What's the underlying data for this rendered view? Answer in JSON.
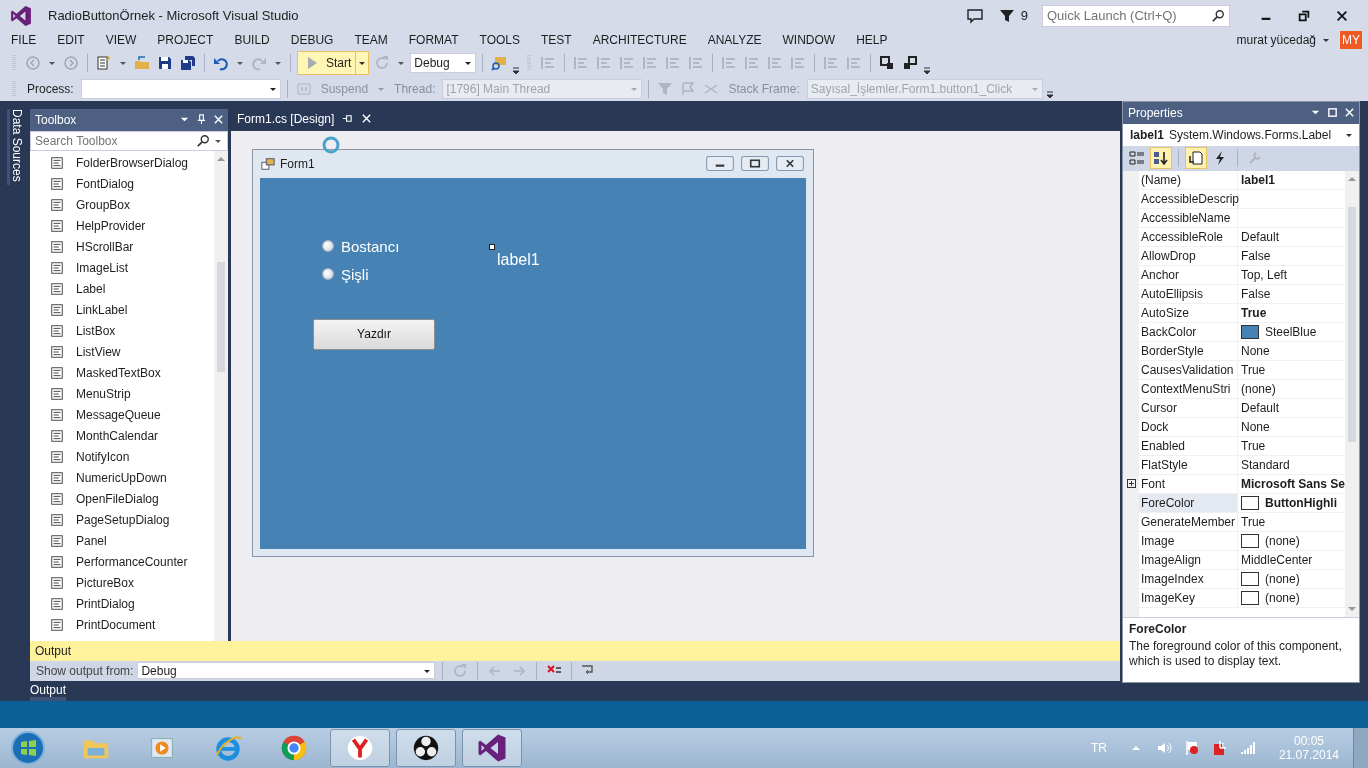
{
  "window": {
    "title": "RadioButtonÖrnek - Microsoft Visual Studio"
  },
  "title_bar": {
    "notification_count": "9",
    "quick_launch": {
      "placeholder": "Quick Launch (Ctrl+Q)"
    }
  },
  "menu": [
    "FILE",
    "EDIT",
    "VIEW",
    "PROJECT",
    "BUILD",
    "DEBUG",
    "TEAM",
    "FORMAT",
    "TOOLS",
    "TEST",
    "ARCHITECTURE",
    "ANALYZE",
    "WINDOW",
    "HELP"
  ],
  "user": {
    "name": "murat yücedağ",
    "initials": "MY"
  },
  "toolbar": {
    "start_label": "Start",
    "configuration": "Debug"
  },
  "debug_toolbar": {
    "process_label": "Process:",
    "suspend_label": "Suspend",
    "thread_label": "Thread:",
    "thread_value": "[1796] Main Thread",
    "stack_frame_label": "Stack Frame:",
    "stack_frame_value": "Sayısal_İşlemler.Form1.button1_Click"
  },
  "side_tab": "Data Sources",
  "toolbox": {
    "title": "Toolbox",
    "search": {
      "placeholder": "Search Toolbox"
    },
    "items": [
      "FolderBrowserDialog",
      "FontDialog",
      "GroupBox",
      "HelpProvider",
      "HScrollBar",
      "ImageList",
      "Label",
      "LinkLabel",
      "ListBox",
      "ListView",
      "MaskedTextBox",
      "MenuStrip",
      "MessageQueue",
      "MonthCalendar",
      "NotifyIcon",
      "NumericUpDown",
      "OpenFileDialog",
      "PageSetupDialog",
      "Panel",
      "PerformanceCounter",
      "PictureBox",
      "PrintDialog",
      "PrintDocument"
    ]
  },
  "document_tab": {
    "title": "Form1.cs [Design]"
  },
  "form": {
    "title": "Form1",
    "radios": [
      {
        "label": "Bostancı",
        "selected": false
      },
      {
        "label": "Şişli",
        "selected": false
      }
    ],
    "label": "label1",
    "button": "Yazdır"
  },
  "properties": {
    "title": "Properties",
    "object_name": "label1",
    "object_type": "System.Windows.Forms.Label",
    "rows": [
      {
        "name": "(Name)",
        "value": "label1",
        "bold": true,
        "selected": false
      },
      {
        "name": "AccessibleDescrip",
        "selected": false
      },
      {
        "name": "AccessibleName",
        "selected": false
      },
      {
        "name": "AccessibleRole",
        "value": "Default",
        "bold": false,
        "selected": false
      },
      {
        "name": "AllowDrop",
        "value": "False",
        "bold": false,
        "selected": false
      },
      {
        "name": "Anchor",
        "value": "Top, Left",
        "bold": false,
        "selected": false
      },
      {
        "name": "AutoEllipsis",
        "value": "False",
        "bold": false,
        "selected": false
      },
      {
        "name": "AutoSize",
        "value": "True",
        "bold": true,
        "selected": false
      },
      {
        "name": "BackColor",
        "value": "SteelBlue",
        "bold": false,
        "selected": false,
        "color": "#4682b4"
      },
      {
        "name": "BorderStyle",
        "value": "None",
        "bold": false,
        "selected": false
      },
      {
        "name": "CausesValidation",
        "value": "True",
        "bold": false,
        "selected": false
      },
      {
        "name": "ContextMenuStri",
        "value": "(none)",
        "bold": false,
        "selected": false
      },
      {
        "name": "Cursor",
        "value": "Default",
        "bold": false,
        "selected": false
      },
      {
        "name": "Dock",
        "value": "None",
        "bold": false,
        "selected": false
      },
      {
        "name": "Enabled",
        "value": "True",
        "bold": false,
        "selected": false
      },
      {
        "name": "FlatStyle",
        "value": "Standard",
        "bold": false,
        "selected": false
      },
      {
        "name": "Font",
        "value": "Microsoft Sans Se",
        "bold": true,
        "selected": false,
        "expanded": false
      },
      {
        "name": "ForeColor",
        "value": "ButtonHighli",
        "bold": true,
        "selected": true,
        "color": "#ffffff"
      },
      {
        "name": "GenerateMember",
        "value": "True",
        "bold": false,
        "selected": false
      },
      {
        "name": "Image",
        "value": "(none)",
        "bold": false,
        "selected": false,
        "color": "#ffffff"
      },
      {
        "name": "ImageAlign",
        "value": "MiddleCenter",
        "bold": false,
        "selected": false
      },
      {
        "name": "ImageIndex",
        "value": "(none)",
        "bold": false,
        "selected": false,
        "color": "#ffffff"
      },
      {
        "name": "ImageKey",
        "value": "(none)",
        "bold": false,
        "selected": false,
        "color": "#ffffff"
      }
    ],
    "description_title": "ForeColor",
    "description": "The foreground color of this component, which is used to display text."
  },
  "output": {
    "title": "Output",
    "source_label": "Show output from:",
    "source": "Debug",
    "tab": "Output"
  },
  "taskbar": {
    "language": "TR",
    "time": "00:05",
    "date": "21.07.2014"
  }
}
